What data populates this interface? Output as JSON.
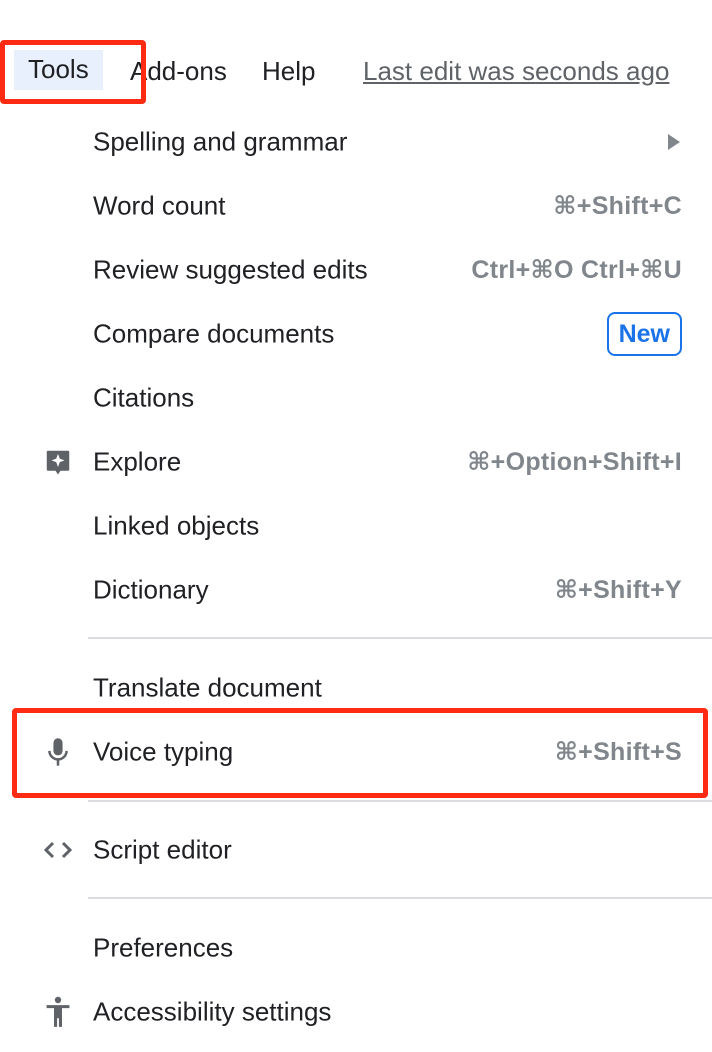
{
  "menubar": {
    "items": [
      {
        "label": "Tools",
        "active": true
      },
      {
        "label": "Add-ons"
      },
      {
        "label": "Help"
      }
    ],
    "last_edit": "Last edit was seconds ago"
  },
  "tools_menu": {
    "items": [
      {
        "label": "Spelling and grammar",
        "submenu": true
      },
      {
        "label": "Word count",
        "shortcut": "⌘+Shift+C"
      },
      {
        "label": "Review suggested edits",
        "shortcut": "Ctrl+⌘O Ctrl+⌘U"
      },
      {
        "label": "Compare documents",
        "badge": "New"
      },
      {
        "label": "Citations"
      },
      {
        "label": "Explore",
        "shortcut": "⌘+Option+Shift+I",
        "icon": "explore-icon"
      },
      {
        "label": "Linked objects"
      },
      {
        "label": "Dictionary",
        "shortcut": "⌘+Shift+Y"
      },
      {
        "label": "Translate document"
      },
      {
        "label": "Voice typing",
        "shortcut": "⌘+Shift+S",
        "icon": "microphone-icon",
        "highlighted": true
      },
      {
        "label": "Script editor",
        "icon": "code-icon"
      },
      {
        "label": "Preferences"
      },
      {
        "label": "Accessibility settings",
        "icon": "accessibility-icon"
      }
    ]
  },
  "colors": {
    "highlight_outline": "#ff2a12",
    "badge_blue": "#1a73e8",
    "active_menu_bg": "#e8f0fe",
    "shortcut_gray": "#80868b"
  }
}
